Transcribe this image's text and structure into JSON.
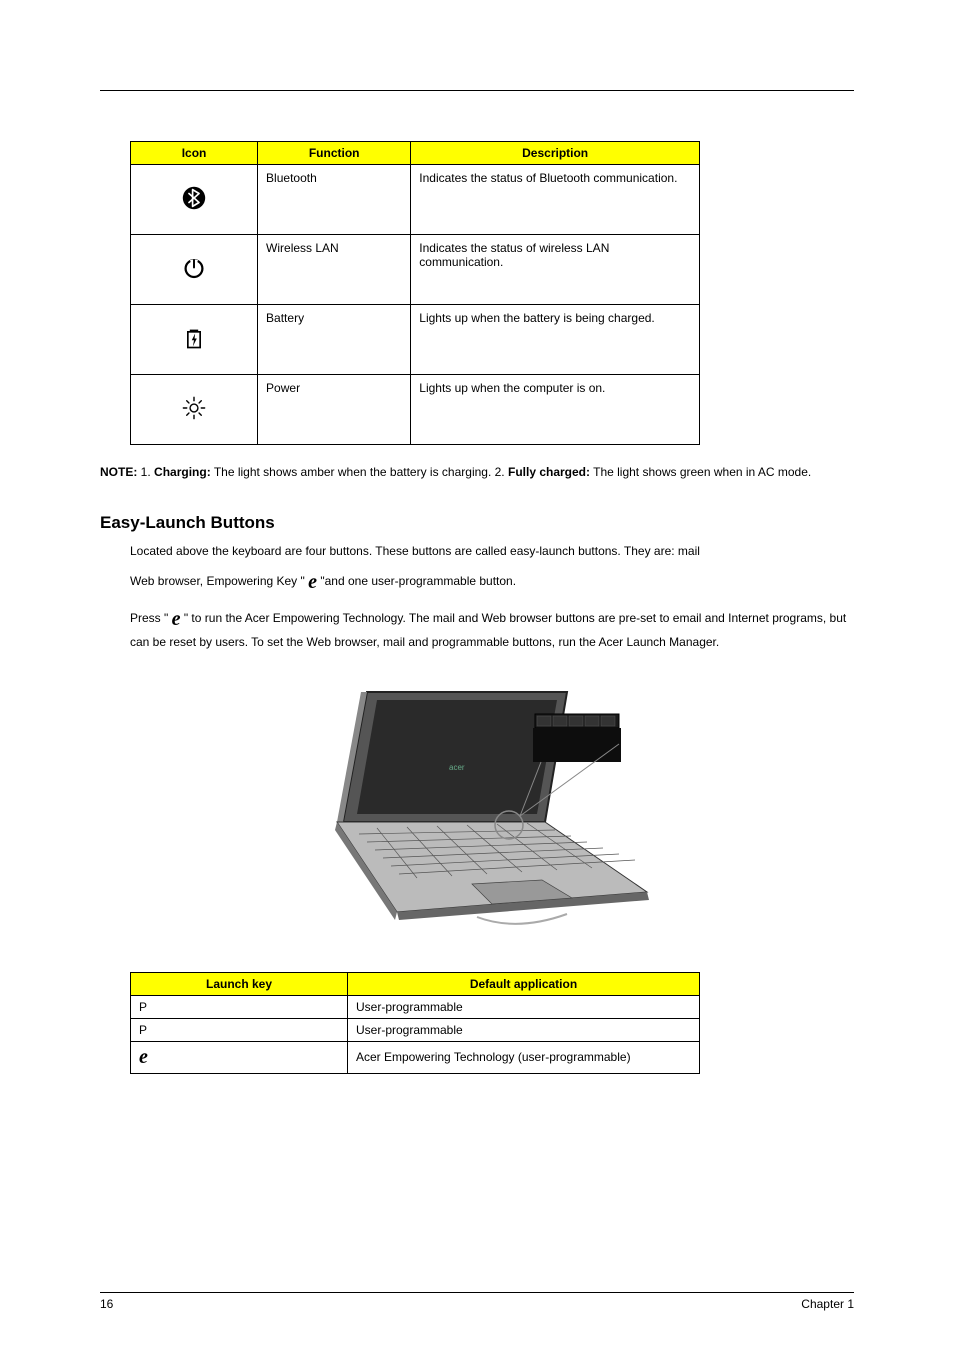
{
  "tables": {
    "icons": {
      "headers": [
        "Icon",
        "Function",
        "Description"
      ],
      "rows": [
        {
          "func": "Bluetooth",
          "desc": "Indicates the status of Bluetooth communication."
        },
        {
          "func": "Wireless LAN",
          "desc": "Indicates the status of wireless LAN communication."
        },
        {
          "func": "Battery",
          "desc": "Lights up when the battery is being charged."
        },
        {
          "func": "Power",
          "desc": "Lights up when the computer is on."
        }
      ]
    },
    "launch": {
      "headers": [
        "Launch key",
        "Default application"
      ],
      "rows": [
        {
          "key": "P",
          "app": "User-programmable"
        },
        {
          "key": "P",
          "app": "User-programmable"
        },
        {
          "key": "e",
          "app": "Acer Empowering Technology (user-programmable)"
        }
      ]
    }
  },
  "note": {
    "label": "NOTE:",
    "text_segments": {
      "pre": " 1. ",
      "charging": "Charging:",
      "mid": " The light shows amber when the battery is charging. 2. ",
      "fully": "Fully charged:",
      "post": " The light shows green when in AC mode."
    }
  },
  "section": {
    "title": "Easy-Launch Buttons",
    "p1": "Located above the keyboard are four buttons. These buttons are called easy-launch buttons. They are: mail",
    "p2a": "Web browser, Empowering Key \" ",
    "p2b": " \"and one user-programmable button.",
    "p3a": "Press \" ",
    "p3b": "  \" to run the Acer Empowering Technology. The mail and Web browser buttons are pre-set to email and Internet programs, but can be reset by users. To set the Web browser, mail and programmable buttons, run the Acer Launch Manager.",
    "e_glyph": "e"
  },
  "footer": {
    "page_num": "16",
    "chapter": "Chapter 1"
  }
}
